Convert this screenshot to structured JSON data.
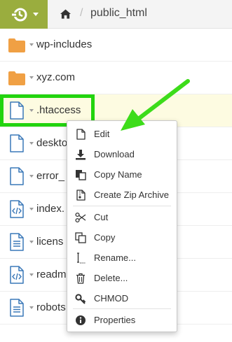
{
  "topbar": {
    "logo_icon": "cpanel-logo-icon",
    "home_icon": "home-icon",
    "separator": "/",
    "current_folder": "public_html"
  },
  "files": [
    {
      "name": "wp-includes",
      "icon": "folder-icon",
      "type": "folder"
    },
    {
      "name": "xyz.com",
      "icon": "folder-icon",
      "type": "folder"
    },
    {
      "name": ".htaccess",
      "icon": "file-icon",
      "type": "file",
      "selected": true
    },
    {
      "name": "deskto",
      "icon": "file-icon",
      "type": "file"
    },
    {
      "name": "error_",
      "icon": "file-icon",
      "type": "file"
    },
    {
      "name": "index.",
      "icon": "code-file-icon",
      "type": "file"
    },
    {
      "name": "licens",
      "icon": "text-file-icon",
      "type": "file"
    },
    {
      "name": "readm",
      "icon": "code-file-icon",
      "type": "file"
    },
    {
      "name": "robots",
      "icon": "text-file-icon",
      "type": "file"
    }
  ],
  "context_menu": {
    "items": [
      {
        "label": "Edit",
        "icon": "edit-icon"
      },
      {
        "label": "Download",
        "icon": "download-icon"
      },
      {
        "label": "Copy Name",
        "icon": "copy-name-icon"
      },
      {
        "label": "Create Zip Archive",
        "icon": "zip-archive-icon"
      },
      {
        "label": "Cut",
        "icon": "scissors-icon"
      },
      {
        "label": "Copy",
        "icon": "copy-icon"
      },
      {
        "label": "Rename...",
        "icon": "rename-cursor-icon"
      },
      {
        "label": "Delete...",
        "icon": "trash-icon"
      },
      {
        "label": "CHMOD",
        "icon": "key-icon"
      },
      {
        "label": "Properties",
        "icon": "info-icon"
      }
    ]
  },
  "annotation": {
    "highlight_color": "#22d40e",
    "arrow_color": "#3ddc1a"
  },
  "colors": {
    "brand": "#9aad3e",
    "selected_row": "#fdfbe1",
    "folder": "#f0a044",
    "file_outline": "#3a78b8"
  }
}
